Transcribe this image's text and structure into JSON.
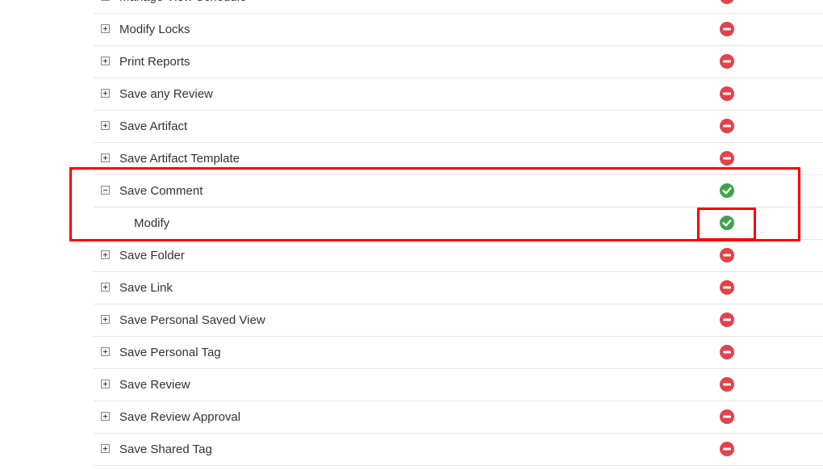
{
  "rows": [
    {
      "label": "Manage View Schedule",
      "kind": "parent",
      "expanded": false,
      "status": "denied"
    },
    {
      "label": "Modify Locks",
      "kind": "parent",
      "expanded": false,
      "status": "denied"
    },
    {
      "label": "Print Reports",
      "kind": "parent",
      "expanded": false,
      "status": "denied"
    },
    {
      "label": "Save any Review",
      "kind": "parent",
      "expanded": false,
      "status": "denied"
    },
    {
      "label": "Save Artifact",
      "kind": "parent",
      "expanded": false,
      "status": "denied"
    },
    {
      "label": "Save Artifact Template",
      "kind": "parent",
      "expanded": false,
      "status": "denied"
    },
    {
      "label": "Save Comment",
      "kind": "parent",
      "expanded": true,
      "status": "allowed"
    },
    {
      "label": "Modify",
      "kind": "child",
      "expanded": false,
      "status": "allowed"
    },
    {
      "label": "Save Folder",
      "kind": "parent",
      "expanded": false,
      "status": "denied"
    },
    {
      "label": "Save Link",
      "kind": "parent",
      "expanded": false,
      "status": "denied"
    },
    {
      "label": "Save Personal Saved View",
      "kind": "parent",
      "expanded": false,
      "status": "denied"
    },
    {
      "label": "Save Personal Tag",
      "kind": "parent",
      "expanded": false,
      "status": "denied"
    },
    {
      "label": "Save Review",
      "kind": "parent",
      "expanded": false,
      "status": "denied"
    },
    {
      "label": "Save Review Approval",
      "kind": "parent",
      "expanded": false,
      "status": "denied"
    },
    {
      "label": "Save Shared Tag",
      "kind": "parent",
      "expanded": false,
      "status": "denied"
    }
  ],
  "icons": {
    "allowed": "allowed-check-icon",
    "denied": "denied-minus-icon",
    "expand": "expand-plus-icon",
    "collapse": "collapse-minus-icon"
  },
  "colors": {
    "allowed": "#3fa34d",
    "denied": "#e2424a",
    "highlight": "#ff0000"
  }
}
